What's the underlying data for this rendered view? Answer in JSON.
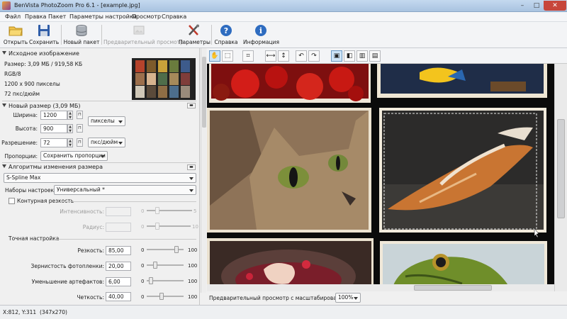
{
  "window": {
    "title": "BenVista PhotoZoom Pro 6.1 - [example.jpg]",
    "min": "–",
    "max": "□",
    "close": "✕"
  },
  "menu": [
    "Файл",
    "Правка",
    "Пакет",
    "Параметры настройки",
    "Просмотр",
    "Справка"
  ],
  "toolbar": {
    "open": "Открыть",
    "save": "Сохранить",
    "new_batch": "Новый пакет",
    "preview": "Предварительный просмотр",
    "settings": "Параметры",
    "help": "Справка",
    "info": "Информация"
  },
  "source": {
    "header": "Исходное изображение",
    "size": "Размер: 3,09 МБ / 919,58 КБ",
    "mode": "RGB/8",
    "pixels": "1200 x 900 пикселы",
    "resolution": "72 пкс/дюйм"
  },
  "new_size": {
    "header": "Новый размер (3,09 МБ)",
    "width_label": "Ширина:",
    "width": "1200",
    "height_label": "Высота:",
    "height": "900",
    "resolution_label": "Разрешение:",
    "resolution": "72",
    "units": "пикселы",
    "res_units": "пкс/дюйм",
    "proportions_label": "Пропорции:",
    "proportions": "Сохранить пропорции"
  },
  "resize": {
    "header": "Алгоритмы изменения размера",
    "method": "S-Spline Max",
    "presets_label": "Наборы настроек:",
    "preset": "Универсальный *"
  },
  "contour": {
    "label": "Контурная резкость",
    "checked": false,
    "intensity_label": "Интенсивность:",
    "intensity_min": "0",
    "intensity_max": "5",
    "radius_label": "Радиус:",
    "radius_min": "0",
    "radius_max": "10"
  },
  "fine": {
    "header": "Точная настройка",
    "sharpness_label": "Резкость:",
    "sharpness": "85,00",
    "sharpness_level": 0.85,
    "grain_label": "Зернистость фотопленки:",
    "grain": "20,00",
    "grain_level": 0.2,
    "artifact_label": "Уменьшение артефактов:",
    "artifact": "6,00",
    "artifact_level": 0.06,
    "clarity_label": "Четкость:",
    "clarity": "40,00",
    "clarity_level": 0.4,
    "min": "0",
    "max": "100"
  },
  "zoom": {
    "label": "Предварительный просмотр с масштабированием:",
    "value": "100%"
  },
  "status": {
    "coords": "X:812, Y:311",
    "dims": "(347x270)"
  },
  "colors": {
    "accent": "#3b6fb6",
    "close": "#c7463b"
  }
}
